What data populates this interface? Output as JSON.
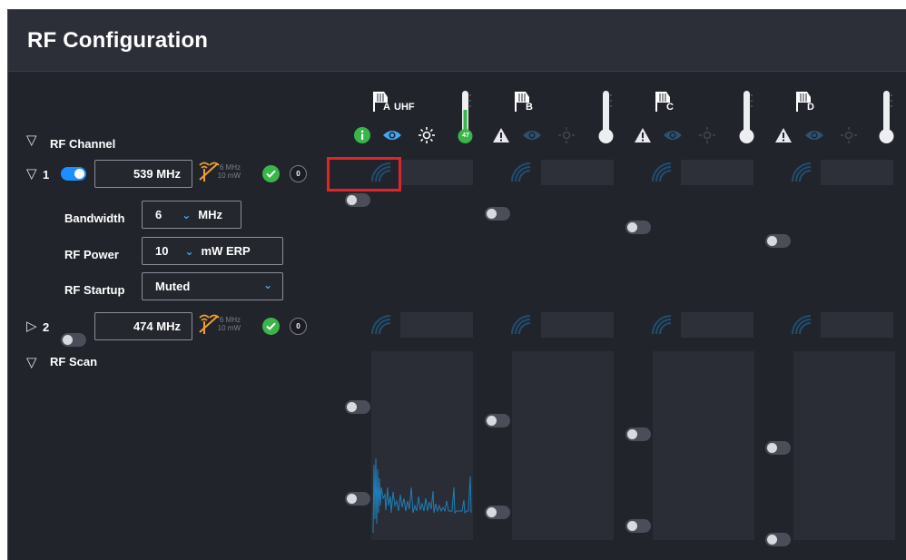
{
  "header": {
    "title": "RF Configuration"
  },
  "section_label": "RF Channel",
  "antennas": [
    {
      "label": "A",
      "band": "UHF",
      "temperature": "47"
    },
    {
      "label": "B"
    },
    {
      "label": "C"
    },
    {
      "label": "D"
    }
  ],
  "channels": [
    {
      "number": "1",
      "enabled": true,
      "frequency": "539",
      "unit": "MHz",
      "info_bw": "6 MHz",
      "info_power": "10 mW",
      "count": "0",
      "bandwidth_label": "Bandwidth",
      "bandwidth_value": "6",
      "bandwidth_unit": "MHz",
      "power_label": "RF Power",
      "power_value": "10",
      "power_unit": "mW ERP",
      "startup_label": "RF Startup",
      "startup_value": "Muted"
    },
    {
      "number": "2",
      "enabled": false,
      "frequency": "474",
      "unit": "MHz",
      "info_bw": "6 MHz",
      "info_power": "10 mW",
      "count": "0"
    }
  ],
  "scan_label": "RF Scan",
  "colors": {
    "accent": "#1a8fff",
    "ok": "#39b54a",
    "warning_highlight": "#e0242a",
    "spectrum": "#1e7fb8"
  }
}
